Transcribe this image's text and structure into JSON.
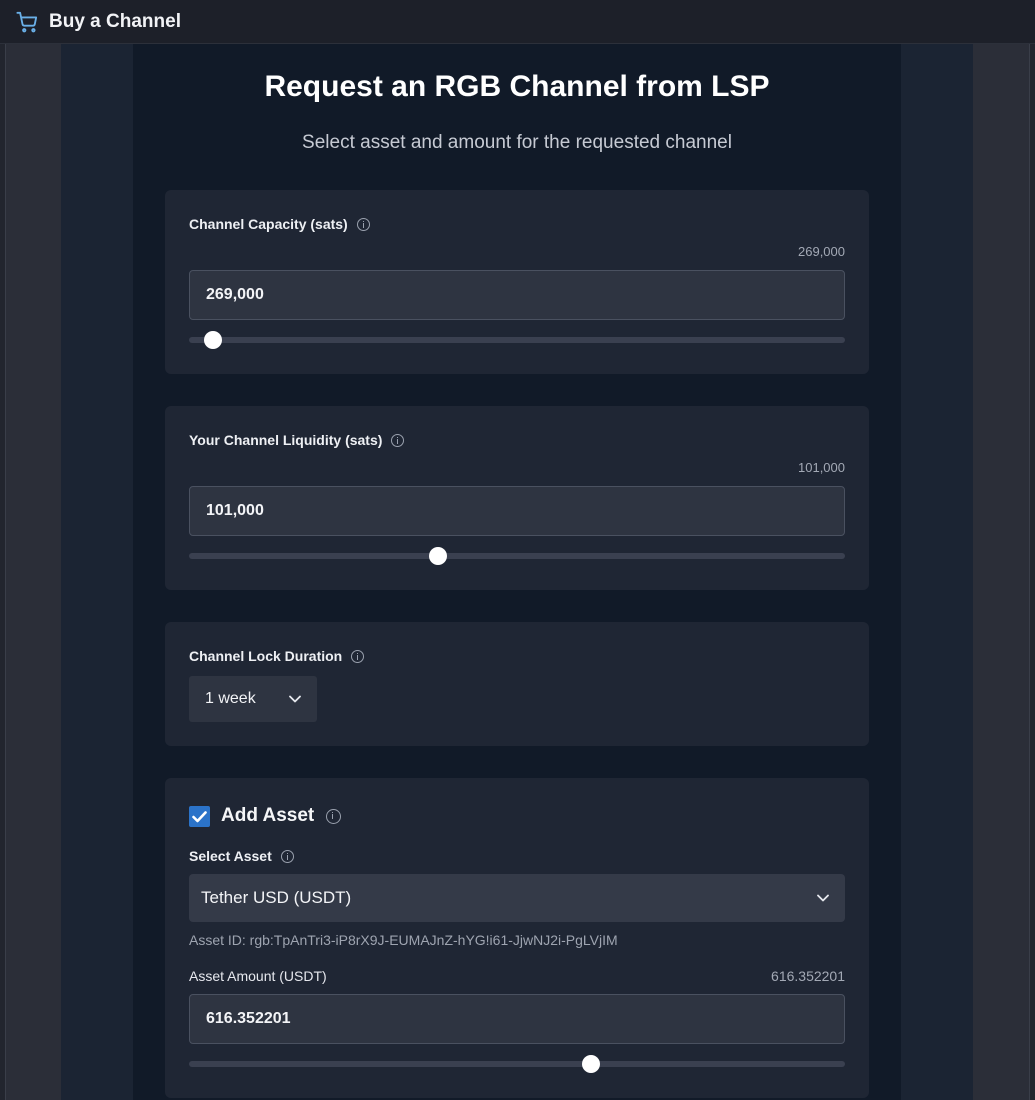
{
  "header": {
    "title": "Buy a Channel",
    "icon": "shopping-cart-icon"
  },
  "page": {
    "title": "Request an RGB Channel from LSP",
    "subtitle": "Select asset and amount for the requested channel"
  },
  "capacity": {
    "label": "Channel Capacity (sats)",
    "max_display": "269,000",
    "value": "269,000",
    "slider_fraction": 0.036
  },
  "liquidity": {
    "label": "Your Channel Liquidity (sats)",
    "max_display": "101,000",
    "value": "101,000",
    "slider_fraction": 0.38
  },
  "lock_duration": {
    "label": "Channel Lock Duration",
    "selected": "1 week"
  },
  "asset": {
    "checkbox_label": "Add Asset",
    "checked": true,
    "select_label": "Select Asset",
    "selected": "Tether USD (USDT)",
    "asset_id": "Asset ID: rgb:TpAnTri3-iP8rX9J-EUMAJnZ-hYG!i61-JjwNJ2i-PgLVjIM",
    "amount_label": "Asset Amount (USDT)",
    "amount_max_display": "616.352201",
    "amount_value": "616.352201",
    "slider_fraction": 0.613
  },
  "colors": {
    "accent_checkbox": "#2b73c9",
    "card_bg": "#1f2634",
    "input_bg": "#2e3441",
    "slider_thumb": "#ffffff"
  }
}
